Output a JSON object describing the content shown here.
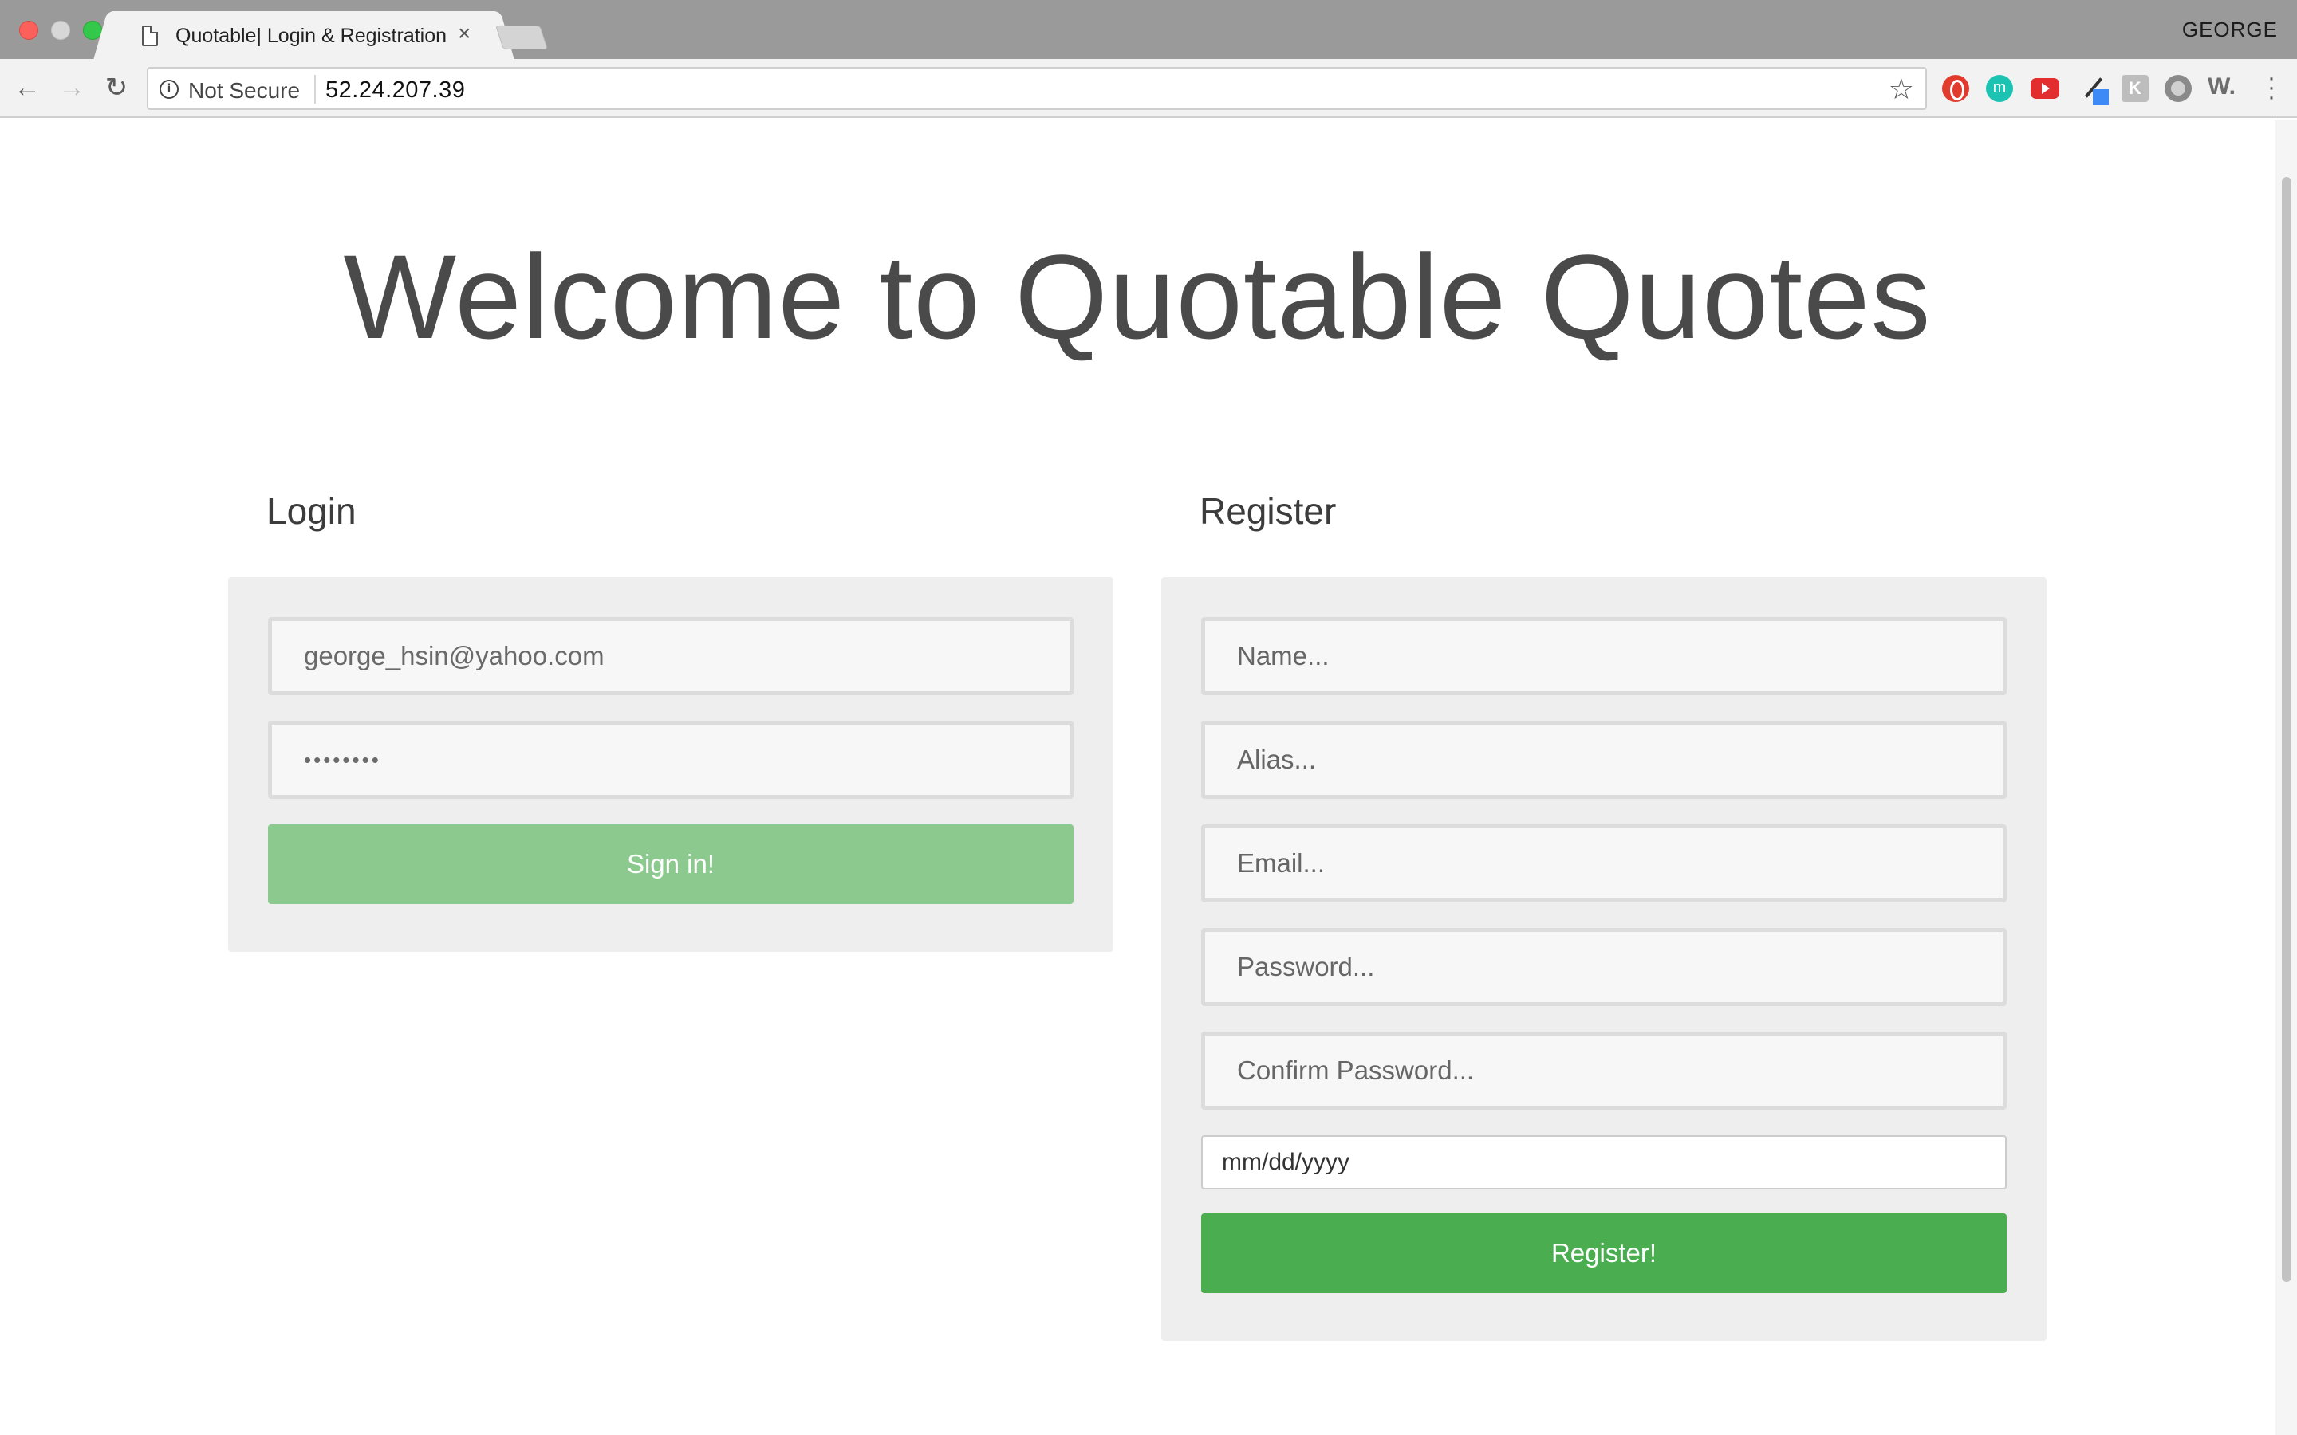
{
  "browser": {
    "tab_title": "Quotable| Login & Registration",
    "tab_close": "×",
    "profile_name": "GEORGE",
    "security_label": "Not Secure",
    "url": "52.24.207.39",
    "extensions": [
      "opera-icon",
      "m-icon",
      "youtube-icon",
      "eyedropper-icon",
      "k-icon",
      "cookie-icon",
      "w-icon"
    ],
    "ext_m_label": "m",
    "ext_k_label": "K",
    "ext_w_label": "W."
  },
  "page": {
    "title": "Welcome to Quotable Quotes"
  },
  "login": {
    "heading": "Login",
    "email_value": "george_hsin@yahoo.com",
    "password_value": "••••••••",
    "submit_label": "Sign in!"
  },
  "register": {
    "heading": "Register",
    "name_placeholder": "Name...",
    "alias_placeholder": "Alias...",
    "email_placeholder": "Email...",
    "password_placeholder": "Password...",
    "confirm_placeholder": "Confirm Password...",
    "dob_placeholder": "mm/dd/yyyy",
    "submit_label": "Register!"
  },
  "colors": {
    "signin_button": "#8bc98e",
    "register_button": "#4aae51",
    "panel_bg": "#eeeeee",
    "tabstrip_bg": "#9a9a9a"
  }
}
